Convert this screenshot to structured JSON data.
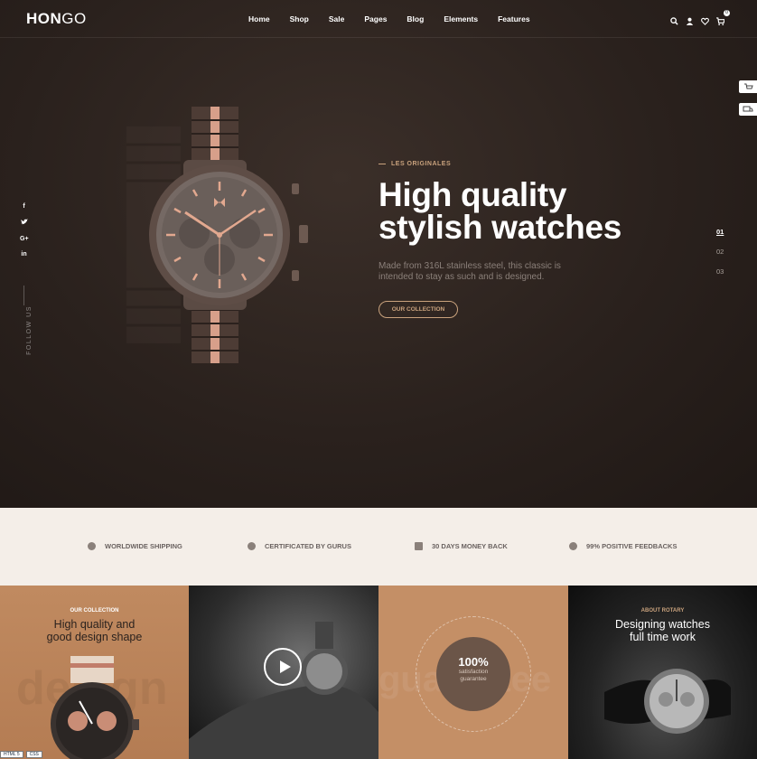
{
  "header": {
    "logo_bold": "HON",
    "logo_light": "GO",
    "nav": [
      "Home",
      "Shop",
      "Sale",
      "Pages",
      "Blog",
      "Elements",
      "Features"
    ],
    "cart_count": "0",
    "icons": [
      "search-icon",
      "user-icon",
      "heart-icon",
      "cart-icon"
    ]
  },
  "social": [
    "f",
    "t",
    "G+",
    "in"
  ],
  "follow_label": "FOLLOW US",
  "hero": {
    "kicker": "LES ORIGINALES",
    "title_line1": "High quality",
    "title_line2": "stylish watches",
    "description": "Made from 316L stainless steel, this classic is intended to stay as such and is designed.",
    "button": "OUR COLLECTION",
    "slides": [
      "01",
      "02",
      "03"
    ],
    "active_slide": "01"
  },
  "features": [
    {
      "label": "WORLDWIDE SHIPPING",
      "icon": "globe-icon"
    },
    {
      "label": "CERTIFICATED BY GURUS",
      "icon": "badge-icon"
    },
    {
      "label": "30 DAYS MONEY BACK",
      "icon": "card-icon"
    },
    {
      "label": "99% POSITIVE FEEDBACKS",
      "icon": "smile-icon"
    }
  ],
  "tiles": {
    "collection_kicker": "OUR COLLECTION",
    "collection_title_1": "High quality and",
    "collection_title_2": "good design shape",
    "collection_bg_word": "design",
    "guarantee_pct": "100%",
    "guarantee_sub1": "satisfaction",
    "guarantee_sub2": "guarantee",
    "guarantee_bg_word": "guarantee",
    "about_kicker": "ABOUT ROTARY",
    "about_title_1": "Designing watches",
    "about_title_2": "full time work"
  },
  "status_items": [
    "HTML 5",
    "CSS"
  ]
}
